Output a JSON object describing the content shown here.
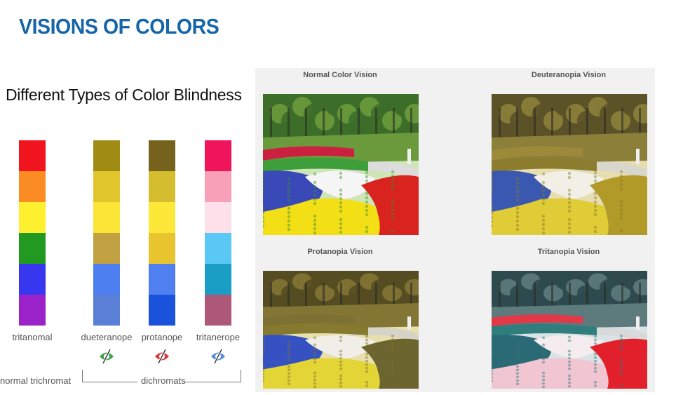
{
  "title": "VISIONS OF COLORS",
  "subtitle": "Different Types of Color Blindness",
  "strips": [
    {
      "label": "tritanomal",
      "colors": [
        "#f0141e",
        "#fb8c23",
        "#fef02e",
        "#229a22",
        "#3737f0",
        "#9b22c8"
      ]
    },
    {
      "label": "dueteranope",
      "colors": [
        "#a08b15",
        "#e0c62c",
        "#fbe536",
        "#c2a142",
        "#4d7ff0",
        "#5a7fd6"
      ],
      "eye_color": "#3fa34d"
    },
    {
      "label": "protanope",
      "colors": [
        "#75621d",
        "#d4bd2e",
        "#fde83a",
        "#e8c52e",
        "#5080f0",
        "#1a52dc"
      ],
      "eye_color": "#e03a3a"
    },
    {
      "label": "tritanerope",
      "colors": [
        "#f0145a",
        "#f7a0b8",
        "#fde0ea",
        "#59c8f5",
        "#1b9ec5",
        "#ad5878"
      ],
      "eye_color": "#5a8ed8"
    }
  ],
  "group_labels": {
    "normal": "normal trichromat",
    "dichromats": "dichromats"
  },
  "panels": [
    {
      "caption": "Normal Color Vision",
      "palette": {
        "sky": "#cfe5b8",
        "trees": "#3c6e2a",
        "trees2": "#6a9a3c",
        "path": "#dcdcdc",
        "band1": "#cc2040",
        "band2": "#3e9e3a",
        "blue": "#3949b8",
        "white": "#f5f5f5",
        "yellow": "#f2df16",
        "red": "#d8231e",
        "green": "#3d8c2c"
      }
    },
    {
      "caption": "Deuteranopia Vision",
      "palette": {
        "sky": "#e6ddb0",
        "trees": "#5c5228",
        "trees2": "#8c7f3a",
        "path": "#d9d6cc",
        "band1": "#9c8a3a",
        "band2": "#8c7d2e",
        "blue": "#3a58b0",
        "white": "#f1efe6",
        "yellow": "#e0cc36",
        "red": "#b29a28",
        "green": "#857a2a"
      }
    },
    {
      "caption": "Protanopia Vision",
      "palette": {
        "sky": "#e7e0ae",
        "trees": "#554c22",
        "trees2": "#837534",
        "path": "#d6d3c8",
        "band1": "#7c7033",
        "band2": "#857a2f",
        "blue": "#3652c2",
        "white": "#f0eee6",
        "yellow": "#e4d536",
        "red": "#6d6530",
        "green": "#7c7230"
      }
    },
    {
      "caption": "Tritanopia Vision",
      "palette": {
        "sky": "#d9e3e6",
        "trees": "#2e4a4e",
        "trees2": "#5d7a7d",
        "path": "#d8dada",
        "band1": "#e23848",
        "band2": "#2f7d7c",
        "blue": "#2a6a74",
        "white": "#f4ecee",
        "yellow": "#f1c6d2",
        "red": "#e2202c",
        "green": "#327775"
      }
    }
  ]
}
